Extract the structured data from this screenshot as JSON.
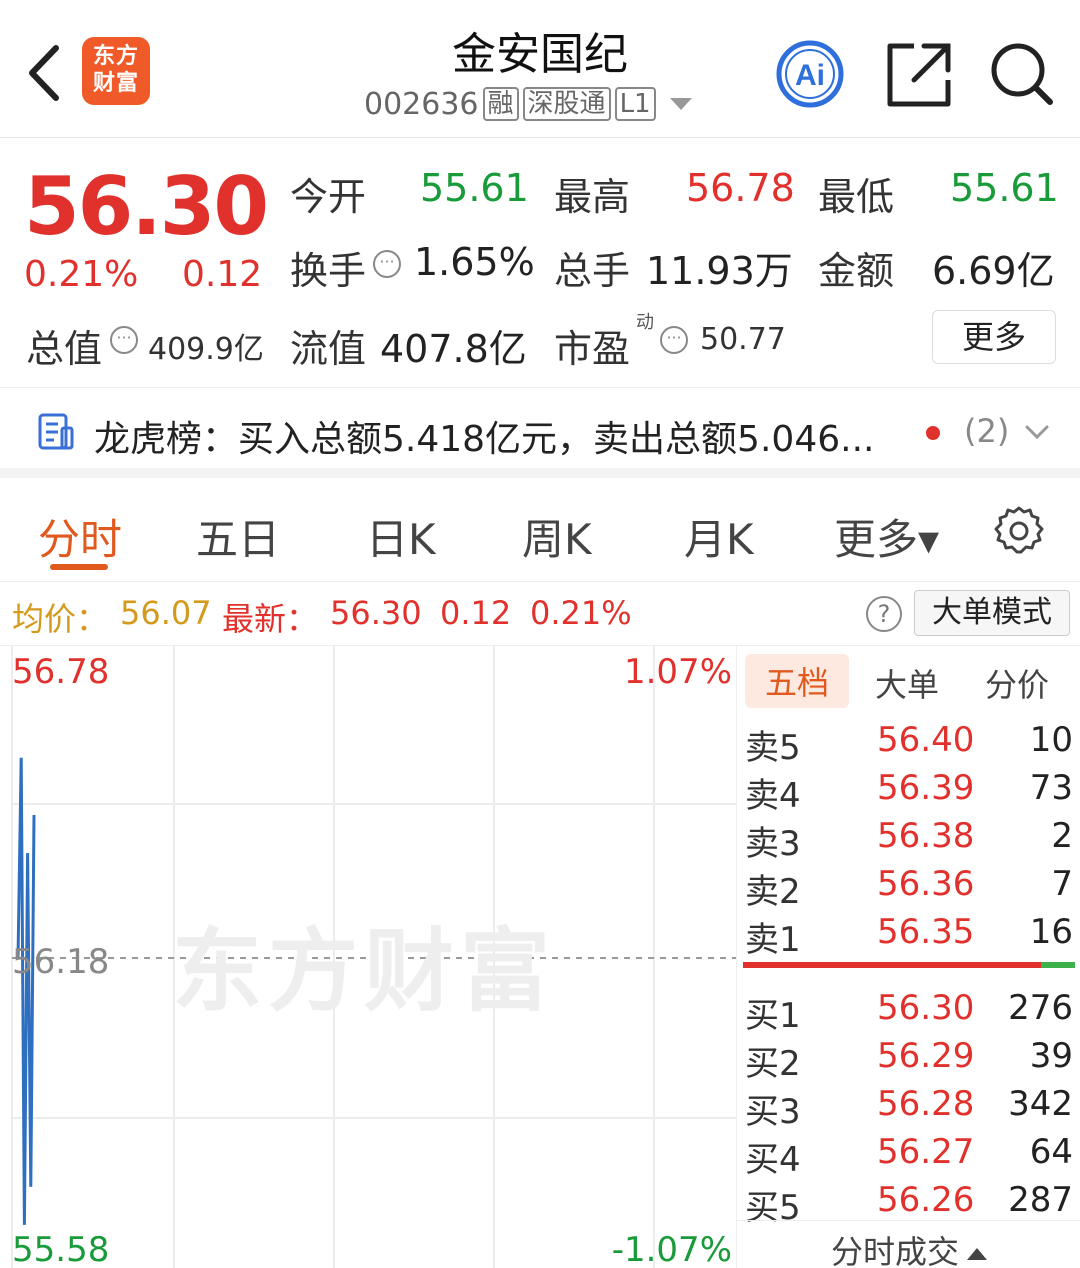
{
  "header": {
    "logo_line1": "东方",
    "logo_line2": "财富",
    "stock_name": "金安国纪",
    "stock_code": "002636",
    "tags": [
      "融",
      "深股通",
      "L1"
    ],
    "icons": [
      "back-arrow-icon",
      "ai-icon",
      "share-icon",
      "search-icon"
    ]
  },
  "quote": {
    "price": "56.30",
    "change_pct": "0.21%",
    "change_abs": "0.12",
    "open_label": "今开",
    "open_value": "55.61",
    "high_label": "最高",
    "high_value": "56.78",
    "low_label": "最低",
    "low_value": "55.61",
    "turnover_label": "换手",
    "turnover_value": "1.65%",
    "volume_label": "总手",
    "volume_value": "11.93万",
    "amount_label": "金额",
    "amount_value": "6.69亿",
    "mktcap_label": "总值",
    "mktcap_value": "409.9亿",
    "float_label": "流值",
    "float_value": "407.8亿",
    "pe_label": "市盈",
    "pe_sup": "动",
    "pe_value": "50.77",
    "more_label": "更多",
    "colors": {
      "up": "#e1312d",
      "down": "#1a9b3a"
    }
  },
  "dragon": {
    "text": "龙虎榜：买入总额5.418亿元，卖出总额5.046...",
    "count": "(2)"
  },
  "tabs": {
    "items": [
      "分时",
      "五日",
      "日K",
      "周K",
      "月K",
      "更多▾"
    ],
    "active": "分时"
  },
  "avgbar": {
    "avg_label": "均价：",
    "avg_value": "56.07",
    "latest_label": "最新：",
    "latest_value": "56.30",
    "latest_change": "0.12",
    "latest_pct": "0.21%",
    "help": "?",
    "big_order_mode": "大单模式"
  },
  "chart": {
    "top_price": "56.78",
    "mid_price": "56.18",
    "bottom_price": "55.58",
    "top_pct": "1.07%",
    "bottom_pct": "-1.07%",
    "watermark": "东方财富"
  },
  "chart_data": {
    "type": "line",
    "title": "",
    "ylim": [
      55.58,
      56.78
    ],
    "y_pct_range": [
      "-1.07%",
      "1.07%"
    ],
    "baseline": 56.18,
    "series": [
      {
        "values": [
          56.18,
          56.6,
          55.62,
          56.4,
          55.7,
          56.48
        ]
      }
    ]
  },
  "book": {
    "tabs": [
      "五档",
      "大单",
      "分价"
    ],
    "active_tab": "五档",
    "asks": [
      {
        "label": "卖5",
        "price": "56.40",
        "volume": "10"
      },
      {
        "label": "卖4",
        "price": "56.39",
        "volume": "73"
      },
      {
        "label": "卖3",
        "price": "56.38",
        "volume": "2"
      },
      {
        "label": "卖2",
        "price": "56.36",
        "volume": "7"
      },
      {
        "label": "卖1",
        "price": "56.35",
        "volume": "16"
      }
    ],
    "bids": [
      {
        "label": "买1",
        "price": "56.30",
        "volume": "276"
      },
      {
        "label": "买2",
        "price": "56.29",
        "volume": "39"
      },
      {
        "label": "买3",
        "price": "56.28",
        "volume": "342"
      },
      {
        "label": "买4",
        "price": "56.27",
        "volume": "64"
      },
      {
        "label": "买5",
        "price": "56.26",
        "volume": "287"
      }
    ],
    "footer": "分时成交"
  }
}
